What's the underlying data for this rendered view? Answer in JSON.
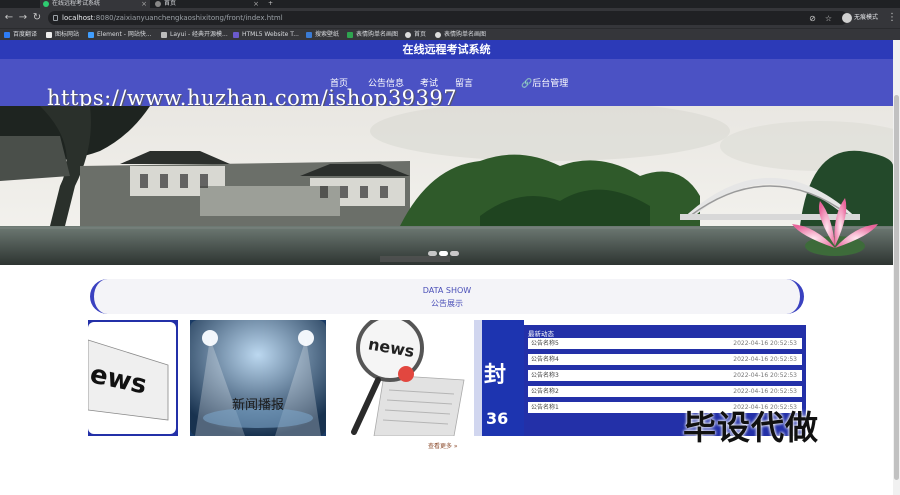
{
  "browser": {
    "tabs": [
      {
        "label": "在线远程考试系统",
        "active": true
      },
      {
        "label": "首页",
        "active": false
      }
    ],
    "url_host": "localhost",
    "url_path": ":8080/zaixianyuanchengkaoshixitong/front/index.html",
    "profile_label": "无痕模式",
    "bookmarks": [
      "百度翻译",
      "图标网站",
      "Element - 网站快...",
      "Layui - 经典开源模...",
      "HTML5 Website T...",
      "搜索壁纸",
      "表情购单名画图",
      "首页",
      "表情购单名画图"
    ]
  },
  "site": {
    "title": "在线远程考试系统",
    "nav": [
      "首页",
      "公告信息",
      "考试",
      "留言",
      "后台管理"
    ],
    "watermark_url": "https://www.huzhan.com/ishop39397"
  },
  "banner": {
    "slides": 3,
    "active_slide": 1
  },
  "notice_section": {
    "title_en": "DATA SHOW",
    "title_cn": "公告展示",
    "card_caption": "新闻播报",
    "card_news_word": "news",
    "news_panel_title": "最新动态",
    "items": [
      {
        "title": "公告名称5",
        "date": "2022-04-16 20:52:53"
      },
      {
        "title": "公告名称4",
        "date": "2022-04-16 20:52:53"
      },
      {
        "title": "公告名称3",
        "date": "2022-04-16 20:52:53"
      },
      {
        "title": "公告名称2",
        "date": "2022-04-16 20:52:53"
      },
      {
        "title": "公告名称1",
        "date": "2022-04-16 20:52:53"
      }
    ],
    "more_label": "查看更多 »"
  },
  "overlay_text": "毕设代做",
  "colors": {
    "brand": "#2c3ab8",
    "nav": "#4b52c4",
    "panel": "#2330a8"
  }
}
